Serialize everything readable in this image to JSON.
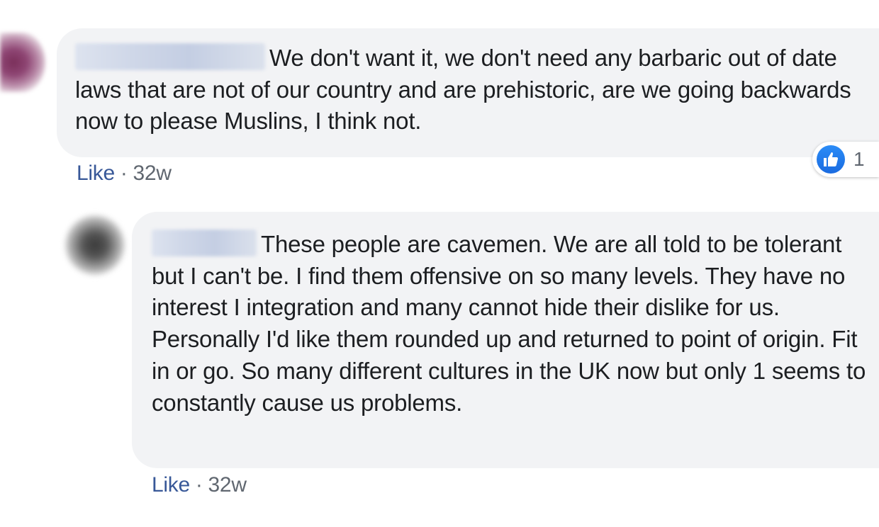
{
  "comments": [
    {
      "text": "We don't want it, we don't need any barbaric out of date laws that are not of our country and are prehistoric, are we going backwards now to please Muslins, I think not.",
      "like_label": "Like",
      "separator": "·",
      "timestamp": "32w",
      "reaction_count": "1",
      "reaction_icon": "thumbs-up-icon"
    },
    {
      "text": "These people are cavemen. We are all told to be tolerant but I can't be. I find them offensive on so many levels. They have no interest I integration and many cannot hide their dislike for us. Personally I'd like them rounded up and returned to point of origin. Fit in or go. So many different cultures in the UK now but only 1 seems to constantly cause us problems.",
      "like_label": "Like",
      "separator": "·",
      "timestamp": "32w"
    }
  ],
  "colors": {
    "bubble_bg": "#f2f3f5",
    "text": "#1c1e21",
    "link": "#385898",
    "meta": "#606770",
    "like_badge": "#1a6be0"
  }
}
